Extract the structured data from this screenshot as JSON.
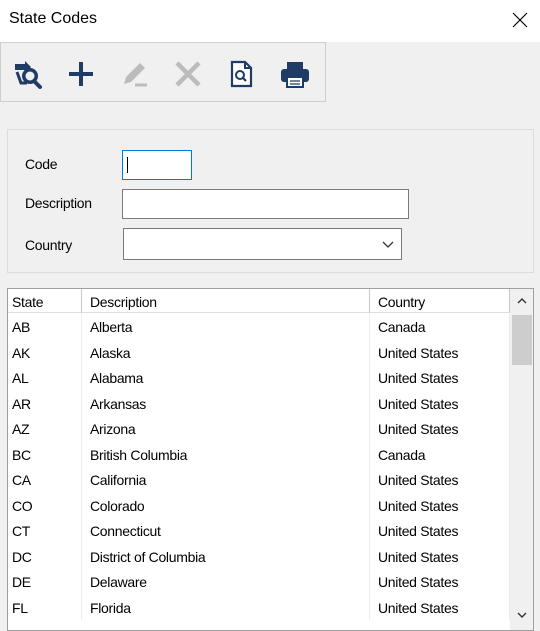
{
  "window": {
    "title": "State Codes",
    "close_icon": "close-icon"
  },
  "toolbar": {
    "buttons": [
      {
        "icon": "search-records-icon",
        "enabled": true
      },
      {
        "icon": "add-icon",
        "enabled": true
      },
      {
        "icon": "edit-icon",
        "enabled": false
      },
      {
        "icon": "delete-icon",
        "enabled": false
      },
      {
        "icon": "preview-icon",
        "enabled": true
      },
      {
        "icon": "print-icon",
        "enabled": true
      }
    ]
  },
  "form": {
    "code_label": "Code",
    "code_value": "",
    "description_label": "Description",
    "description_value": "",
    "country_label": "Country",
    "country_value": ""
  },
  "grid": {
    "columns": [
      "State",
      "Description",
      "Country"
    ],
    "rows": [
      [
        "AB",
        "Alberta",
        "Canada"
      ],
      [
        "AK",
        "Alaska",
        "United States"
      ],
      [
        "AL",
        "Alabama",
        "United States"
      ],
      [
        "AR",
        "Arkansas",
        "United States"
      ],
      [
        "AZ",
        "Arizona",
        "United States"
      ],
      [
        "BC",
        "British Columbia",
        "Canada"
      ],
      [
        "CA",
        "California",
        "United States"
      ],
      [
        "CO",
        "Colorado",
        "United States"
      ],
      [
        "CT",
        "Connecticut",
        "United States"
      ],
      [
        "DC",
        "District of Columbia",
        "United States"
      ],
      [
        "DE",
        "Delaware",
        "United States"
      ],
      [
        "FL",
        "Florida",
        "United States"
      ]
    ]
  },
  "colors": {
    "focus_border": "#0078d7",
    "icon_active": "#1f3c66",
    "icon_disabled": "#bcbcbc"
  }
}
